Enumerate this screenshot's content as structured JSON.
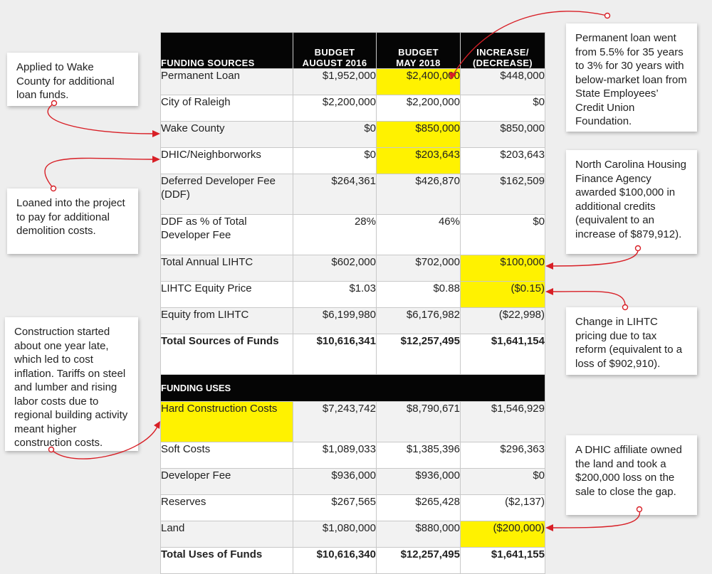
{
  "table": {
    "headers": {
      "sources_label": "FUNDING SOURCES",
      "col_aug_2016": "BUDGET\nAUGUST 2016",
      "col_may_2018": "BUDGET\nMAY 2018",
      "col_change": "INCREASE/\n(DECREASE)",
      "uses_label": "FUNDING USES"
    },
    "sources": [
      {
        "label": "Permanent Loan",
        "aug2016": "$1,952,000",
        "may2018": "$2,400,000",
        "change": "$448,000"
      },
      {
        "label": "City of Raleigh",
        "aug2016": "$2,200,000",
        "may2018": "$2,200,000",
        "change": "$0"
      },
      {
        "label": "Wake County",
        "aug2016": "$0",
        "may2018": "$850,000",
        "change": "$850,000"
      },
      {
        "label": "DHIC/Neighborworks",
        "aug2016": "$0",
        "may2018": "$203,643",
        "change": "$203,643"
      },
      {
        "label": "Deferred Developer Fee (DDF)",
        "aug2016": "$264,361",
        "may2018": "$426,870",
        "change": "$162,509"
      },
      {
        "label": "DDF as % of Total Developer Fee",
        "aug2016": "28%",
        "may2018": "46%",
        "change": "$0"
      },
      {
        "label": "Total Annual LIHTC",
        "aug2016": "$602,000",
        "may2018": "$702,000",
        "change": "$100,000"
      },
      {
        "label": "LIHTC Equity Price",
        "aug2016": "$1.03",
        "may2018": "$0.88",
        "change": "($0.15)"
      },
      {
        "label": "Equity from LIHTC",
        "aug2016": "$6,199,980",
        "may2018": "$6,176,982",
        "change": "($22,998)"
      },
      {
        "label": "Total Sources of Funds",
        "aug2016": "$10,616,341",
        "may2018": "$12,257,495",
        "change": "$1,641,154"
      }
    ],
    "uses": [
      {
        "label": "Hard Construction Costs",
        "aug2016": "$7,243,742",
        "may2018": "$8,790,671",
        "change": "$1,546,929"
      },
      {
        "label": "Soft Costs",
        "aug2016": "$1,089,033",
        "may2018": "$1,385,396",
        "change": "$296,363"
      },
      {
        "label": "Developer Fee",
        "aug2016": "$936,000",
        "may2018": "$936,000",
        "change": "$0"
      },
      {
        "label": "Reserves",
        "aug2016": "$267,565",
        "may2018": "$265,428",
        "change": "($2,137)"
      },
      {
        "label": "Land",
        "aug2016": "$1,080,000",
        "may2018": "$880,000",
        "change": "($200,000)"
      },
      {
        "label": "Total Uses of Funds",
        "aug2016": "$10,616,340",
        "may2018": "$12,257,495",
        "change": "$1,641,155"
      }
    ]
  },
  "annotations": {
    "wake_county": "Applied to Wake County for additional loan funds.",
    "demolition": "Loaned into the project to pay for additional demolition costs.",
    "construction": "Construction started about one year late, which led to cost inflation. Tariffs on steel and lumber and rising labor costs due to regional building activity meant higher construction costs.",
    "permanent_loan": "Permanent loan went from 5.5% for 35 years to 3% for 30 years with below-market loan from State Employees’ Credit Union Foundation.",
    "nchfa": "North Carolina Housing Finance Agency awarded $100,000 in additional credits (equivalent to an increase of $879,912).",
    "lihtc_pricing": "Change in LIHTC pricing due to tax reform (equivalent to a loss of $902,910).",
    "land": "A DHIC affiliate owned the land and took a $200,000 loss on the sale to close the gap."
  },
  "colors": {
    "highlight": "#fff200",
    "header_bg": "#050505",
    "arrow": "#d81f26",
    "background": "#eeeeee"
  }
}
